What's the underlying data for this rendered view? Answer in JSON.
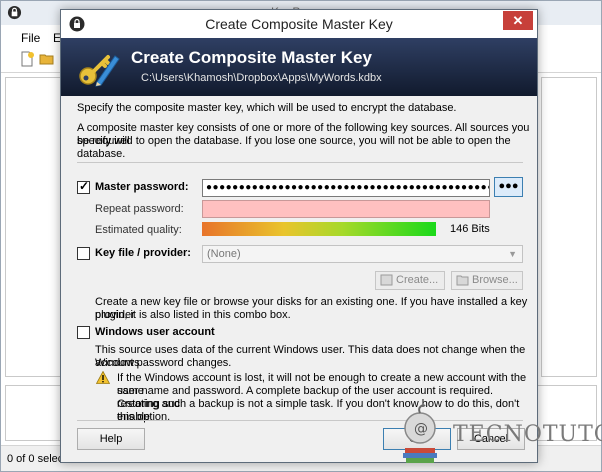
{
  "background": {
    "window_title": "KeePass",
    "menu": [
      "File",
      "E"
    ],
    "status_text": "0 of 0 selec"
  },
  "dialog": {
    "title": "Create Composite Master Key",
    "close_glyph": "✕",
    "banner": {
      "title": "Create Composite Master Key",
      "path": "C:\\Users\\Khamosh\\Dropbox\\Apps\\MyWords.kdbx"
    },
    "intro": "Specify the composite master key, which will be used to encrypt the database.",
    "description_line1": "A composite master key consists of one or more of the following key sources. All sources you specify will",
    "description_line2": "be required to open the database.  If you lose one source, you will not be able to open the database.",
    "master_password": {
      "checked": true,
      "label": "Master password:",
      "value": "●●●●●●●●●●●●●●●●●●●●●●●●●●●●●●●●●●●●●●●●●●●●●●●●●●●●●●",
      "reveal_button": "●●●",
      "repeat_label": "Repeat password:",
      "quality_label": "Estimated quality:",
      "quality_value": "146 Bits",
      "quality_fraction": 1.0
    },
    "key_file": {
      "checked": false,
      "label": "Key file / provider:",
      "selected": "(None)",
      "create_button": "Create...",
      "browse_button": "Browse...",
      "help_line1": "Create a new key file or browse your disks for an existing one. If you have installed a key provider",
      "help_line2": "plugin, it is also listed in this combo box."
    },
    "windows_account": {
      "checked": false,
      "label": "Windows user account",
      "desc_line1": "This source uses data of the current Windows user. This data does not change when the Windows",
      "desc_line2": "account password changes.",
      "warn_line1": "If the Windows account is lost, it will not be enough to create a new account with the same",
      "warn_line2": "user name and password. A complete backup of the user account is required. Creating and",
      "warn_line3": "restoring such a backup is not a simple task. If you don't know how to do this, don't enable",
      "warn_line4": "this option."
    },
    "buttons": {
      "help": "Help",
      "ok": "OK",
      "cancel": "Cancel"
    }
  },
  "watermark": {
    "text": "TECNOTUTO"
  },
  "colors": {
    "banner_top": "#2f3f63",
    "banner_bottom": "#111a2d",
    "repeat_field_bg": "#ffc0c0",
    "close_button": "#c7403a"
  }
}
